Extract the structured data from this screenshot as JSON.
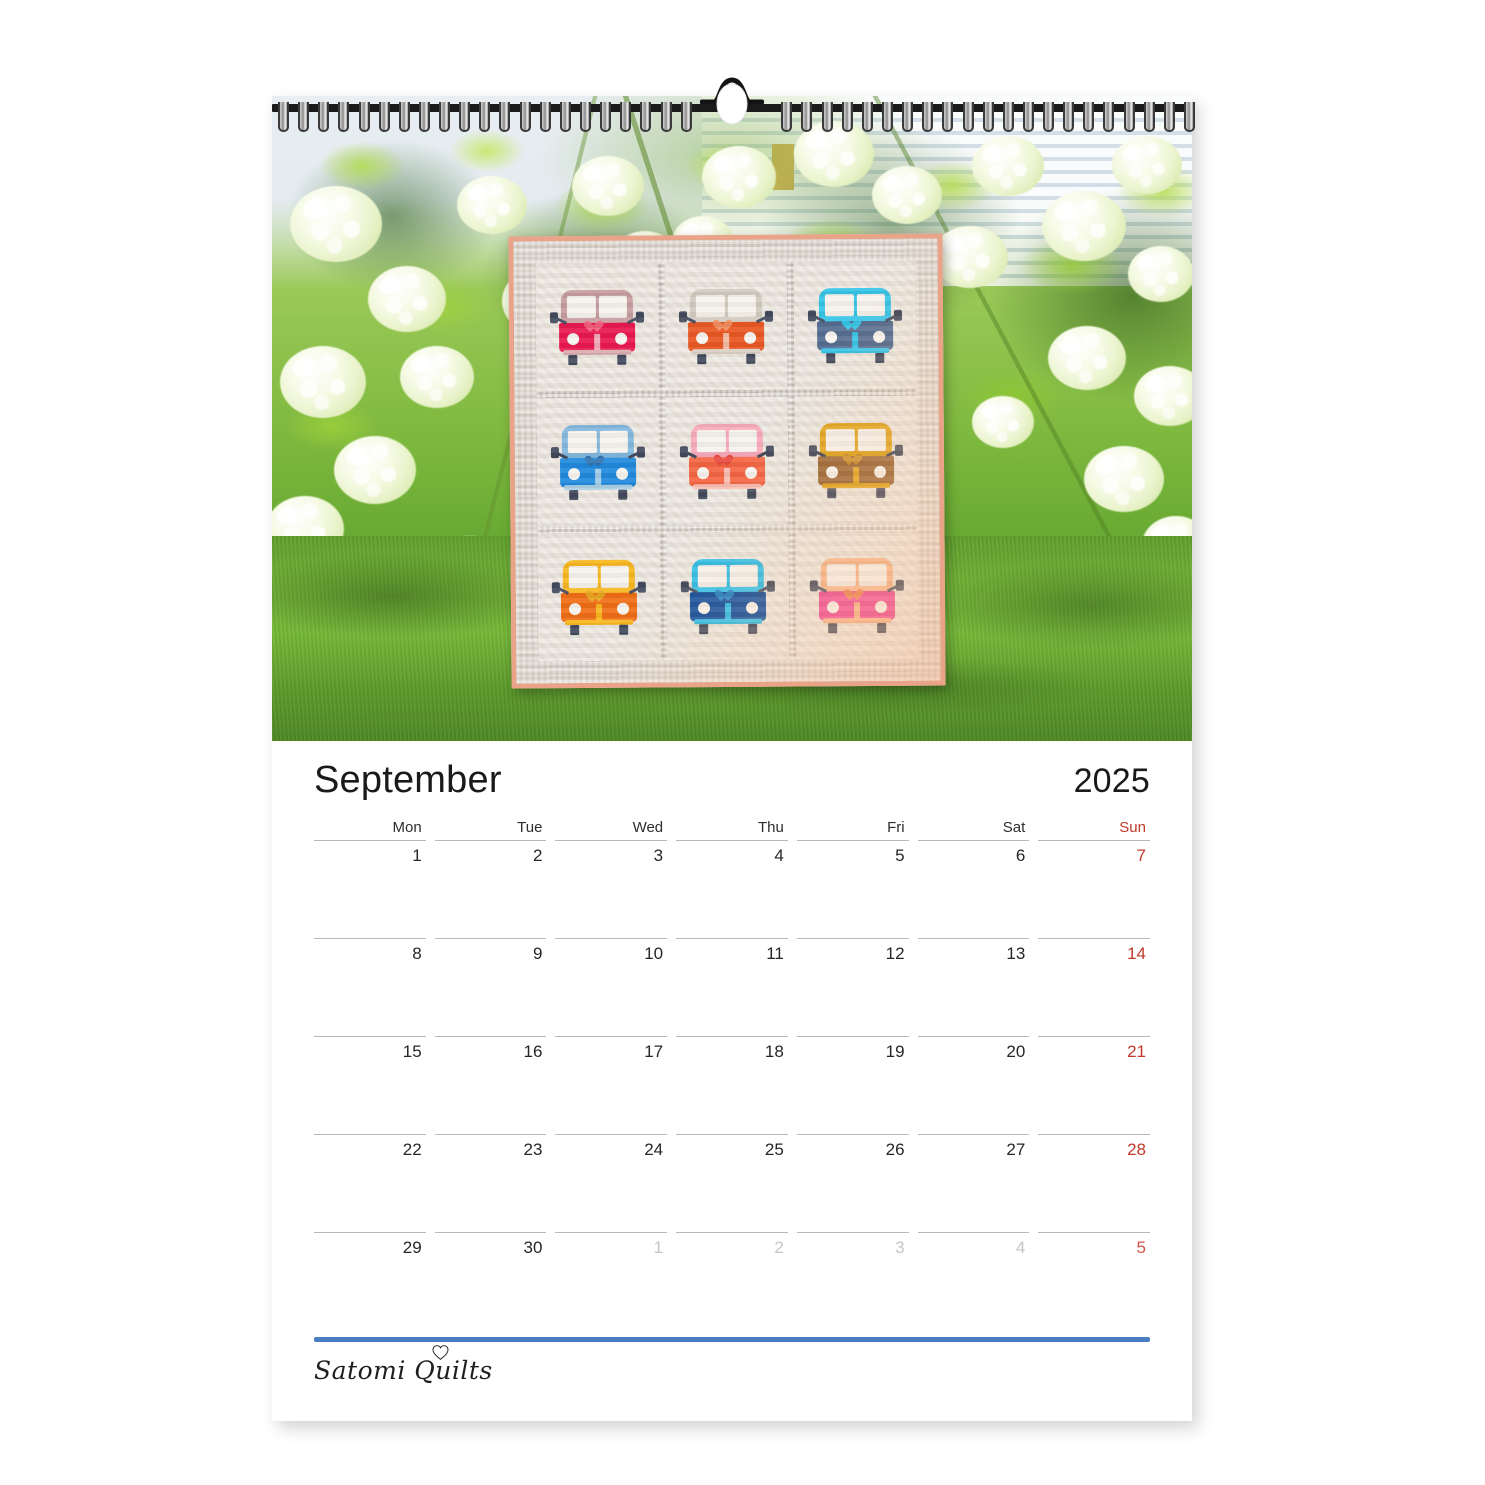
{
  "calendar": {
    "month": "September",
    "year": "2025",
    "weekdays": [
      {
        "label": "Mon",
        "weekend": false
      },
      {
        "label": "Tue",
        "weekend": false
      },
      {
        "label": "Wed",
        "weekend": false
      },
      {
        "label": "Thu",
        "weekend": false
      },
      {
        "label": "Fri",
        "weekend": false
      },
      {
        "label": "Sat",
        "weekend": false
      },
      {
        "label": "Sun",
        "weekend": true
      }
    ],
    "weeks": [
      [
        {
          "day": "1",
          "muted": false
        },
        {
          "day": "2",
          "muted": false
        },
        {
          "day": "3",
          "muted": false
        },
        {
          "day": "4",
          "muted": false
        },
        {
          "day": "5",
          "muted": false
        },
        {
          "day": "6",
          "muted": false
        },
        {
          "day": "7",
          "muted": false
        }
      ],
      [
        {
          "day": "8",
          "muted": false
        },
        {
          "day": "9",
          "muted": false
        },
        {
          "day": "10",
          "muted": false
        },
        {
          "day": "11",
          "muted": false
        },
        {
          "day": "12",
          "muted": false
        },
        {
          "day": "13",
          "muted": false
        },
        {
          "day": "14",
          "muted": false
        }
      ],
      [
        {
          "day": "15",
          "muted": false
        },
        {
          "day": "16",
          "muted": false
        },
        {
          "day": "17",
          "muted": false
        },
        {
          "day": "18",
          "muted": false
        },
        {
          "day": "19",
          "muted": false
        },
        {
          "day": "20",
          "muted": false
        },
        {
          "day": "21",
          "muted": false
        }
      ],
      [
        {
          "day": "22",
          "muted": false
        },
        {
          "day": "23",
          "muted": false
        },
        {
          "day": "24",
          "muted": false
        },
        {
          "day": "25",
          "muted": false
        },
        {
          "day": "26",
          "muted": false
        },
        {
          "day": "27",
          "muted": false
        },
        {
          "day": "28",
          "muted": false
        }
      ],
      [
        {
          "day": "29",
          "muted": false
        },
        {
          "day": "30",
          "muted": false
        },
        {
          "day": "1",
          "muted": true
        },
        {
          "day": "2",
          "muted": true
        },
        {
          "day": "3",
          "muted": true
        },
        {
          "day": "4",
          "muted": true
        },
        {
          "day": "5",
          "muted": true
        }
      ]
    ]
  },
  "footer": {
    "brand": "Satomi Quilts",
    "rule_color": "#4a7ec4"
  },
  "photo": {
    "description": "Campervan quilt hanging outdoors in front of white hydrangea bushes",
    "quilt": {
      "binding_color": "#e9a389",
      "background_color": "#d8d1c8",
      "blocks": [
        {
          "position": "top-left",
          "top_color": "#c49a9c",
          "body_color": "#e8114b",
          "heart_color": "#f05a7a"
        },
        {
          "position": "top-center",
          "top_color": "#cfc9bd",
          "body_color": "#e8531c",
          "heart_color": "#f08a5a"
        },
        {
          "position": "top-right",
          "top_color": "#2fc3e8",
          "body_color": "#50698f",
          "heart_color": "#2fc3e8"
        },
        {
          "position": "middle-left",
          "top_color": "#7fb6dd",
          "body_color": "#1a86dd",
          "heart_color": "#2b6fae"
        },
        {
          "position": "middle-center",
          "top_color": "#f7a8b8",
          "body_color": "#f4613e",
          "heart_color": "#e8443a"
        },
        {
          "position": "middle-right",
          "top_color": "#e0a316",
          "body_color": "#96602c",
          "heart_color": "#c98a22"
        },
        {
          "position": "bottom-left",
          "top_color": "#f7b518",
          "body_color": "#ef6a10",
          "heart_color": "#e8a21a"
        },
        {
          "position": "bottom-center",
          "top_color": "#27bde8",
          "body_color": "#0a4a9c",
          "heart_color": "#1a7fc4"
        },
        {
          "position": "bottom-right",
          "top_color": "#f6b184",
          "body_color": "#ef3f93",
          "heart_color": "#f07a4a"
        }
      ]
    }
  },
  "binding": {
    "type": "wire-spiral",
    "coil_count": 46,
    "hook_label": "hanging-hook"
  }
}
